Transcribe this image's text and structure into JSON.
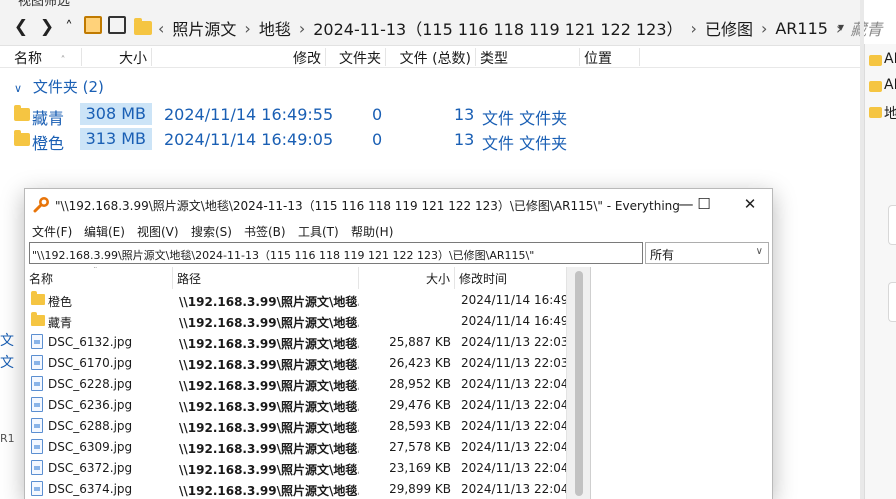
{
  "explorer": {
    "top_strip_text": "视图筛选",
    "breadcrumbs": [
      "照片源文",
      "地毯",
      "2024-11-13（115 116 118 119 121 122 123）",
      "已修图",
      "AR115"
    ],
    "breadcrumb_tail": "藏青",
    "columns": [
      "名称",
      "大小",
      "修改",
      "文件夹",
      "文件 (总数)",
      "类型",
      "位置"
    ],
    "group_label": "文件夹 (2)",
    "rows": [
      {
        "name": "藏青",
        "size": "308 MB",
        "date": "2024/11/14  16:49:55",
        "folders": "0",
        "files": "13",
        "type": "文件 文件夹"
      },
      {
        "name": "橙色",
        "size": "313 MB",
        "date": "2024/11/14  16:49:05",
        "folders": "0",
        "files": "13",
        "type": "文件 文件夹"
      }
    ],
    "right_pane_items": [
      "AR",
      "AR",
      "地"
    ],
    "left_fragments": [
      "文",
      "文",
      "R1"
    ]
  },
  "everything": {
    "title": "\"\\\\192.168.3.99\\照片源文\\地毯\\2024-11-13（115 116 118 119 121 122 123）\\已修图\\AR115\\\" - Everything",
    "menu": [
      "文件(F)",
      "编辑(E)",
      "视图(V)",
      "搜索(S)",
      "书签(B)",
      "工具(T)",
      "帮助(H)"
    ],
    "search_value": "\"\\\\192.168.3.99\\照片源文\\地毯\\2024-11-13（115 116 118 119 121 122 123）\\已修图\\AR115\\\"",
    "filter_value": "所有",
    "columns": {
      "name": "名称",
      "path": "路径",
      "size": "大小",
      "modified": "修改时间"
    },
    "rows": [
      {
        "type": "folder",
        "name": "橙色",
        "path": "\\\\192.168.3.99\\照片源文\\地毯...",
        "size": "",
        "date": "2024/11/14 16:49"
      },
      {
        "type": "folder",
        "name": "藏青",
        "path": "\\\\192.168.3.99\\照片源文\\地毯...",
        "size": "",
        "date": "2024/11/14 16:49"
      },
      {
        "type": "file",
        "name": "DSC_6132.jpg",
        "path": "\\\\192.168.3.99\\照片源文\\地毯...",
        "size": "25,887 KB",
        "date": "2024/11/13 22:03"
      },
      {
        "type": "file",
        "name": "DSC_6170.jpg",
        "path": "\\\\192.168.3.99\\照片源文\\地毯...",
        "size": "26,423 KB",
        "date": "2024/11/13 22:03"
      },
      {
        "type": "file",
        "name": "DSC_6228.jpg",
        "path": "\\\\192.168.3.99\\照片源文\\地毯...",
        "size": "28,952 KB",
        "date": "2024/11/13 22:04"
      },
      {
        "type": "file",
        "name": "DSC_6236.jpg",
        "path": "\\\\192.168.3.99\\照片源文\\地毯...",
        "size": "29,476 KB",
        "date": "2024/11/13 22:04"
      },
      {
        "type": "file",
        "name": "DSC_6288.jpg",
        "path": "\\\\192.168.3.99\\照片源文\\地毯...",
        "size": "28,593 KB",
        "date": "2024/11/13 22:04"
      },
      {
        "type": "file",
        "name": "DSC_6309.jpg",
        "path": "\\\\192.168.3.99\\照片源文\\地毯...",
        "size": "27,578 KB",
        "date": "2024/11/13 22:04"
      },
      {
        "type": "file",
        "name": "DSC_6372.jpg",
        "path": "\\\\192.168.3.99\\照片源文\\地毯...",
        "size": "23,169 KB",
        "date": "2024/11/13 22:04"
      },
      {
        "type": "file",
        "name": "DSC_6374.jpg",
        "path": "\\\\192.168.3.99\\照片源文\\地毯...",
        "size": "29,899 KB",
        "date": "2024/11/13 22:04"
      }
    ]
  },
  "icons": {
    "back": "chevron-left-icon",
    "forward": "chevron-right-icon",
    "up": "chevron-up-icon",
    "app_logo": "magnifier-icon",
    "folder": "folder-icon",
    "file": "image-file-icon"
  },
  "colors": {
    "accent_blue": "#1a5fb4",
    "selection_fill": "#cce4f7",
    "folder_yellow": "#f5c542",
    "logo_orange": "#e8750a"
  }
}
